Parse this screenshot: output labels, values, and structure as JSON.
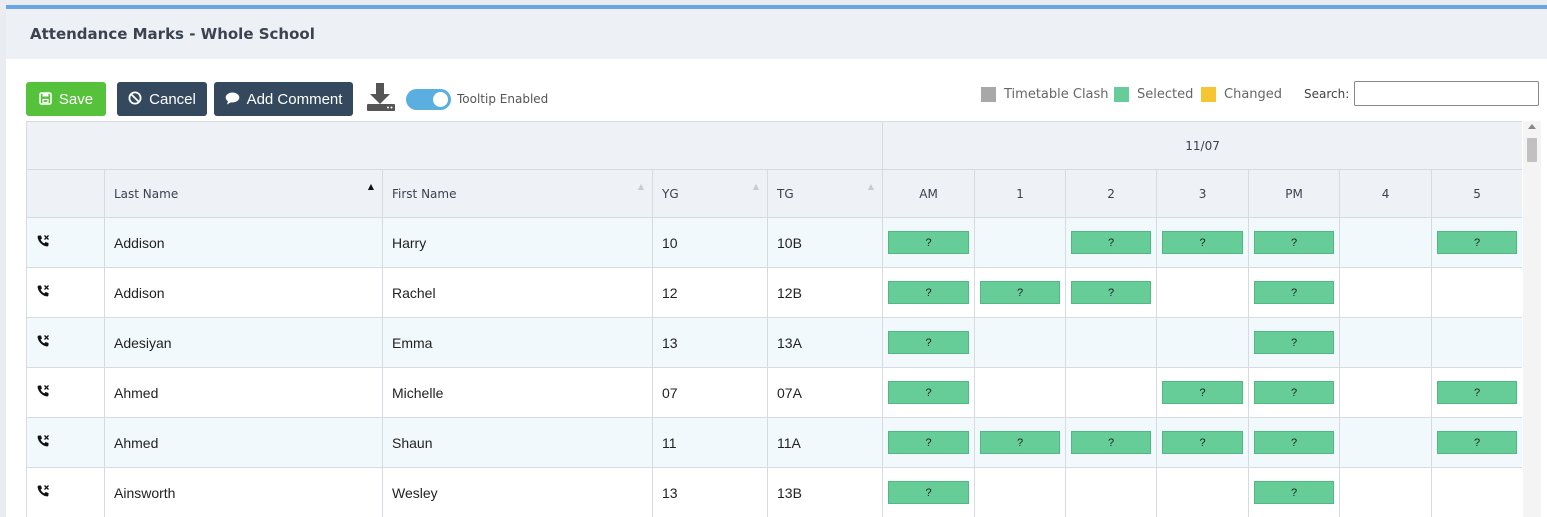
{
  "panel": {
    "title": "Attendance Marks - Whole School"
  },
  "toolbar": {
    "save_label": "Save",
    "cancel_label": "Cancel",
    "add_comment_label": "Add Comment",
    "download_icon": "download-icon",
    "tooltip_label": "Tooltip Enabled",
    "tooltip_enabled": true
  },
  "legend": {
    "timetable_clash": {
      "label": "Timetable Clash",
      "color": "#a8a8a8"
    },
    "selected": {
      "label": "Selected",
      "color": "#66cc98"
    },
    "changed": {
      "label": "Changed",
      "color": "#f7c531"
    }
  },
  "search": {
    "label": "Search:",
    "value": ""
  },
  "table": {
    "date": "11/07",
    "columns": {
      "last_name": "Last Name",
      "first_name": "First Name",
      "yg": "YG",
      "tg": "TG"
    },
    "periods": [
      "AM",
      "1",
      "2",
      "3",
      "PM",
      "4",
      "5"
    ],
    "rows": [
      {
        "last_name": "Addison",
        "first_name": "Harry",
        "yg": "10",
        "tg": "10B",
        "marks": [
          "?",
          "",
          "?",
          "?",
          "?",
          "",
          "?"
        ]
      },
      {
        "last_name": "Addison",
        "first_name": "Rachel",
        "yg": "12",
        "tg": "12B",
        "marks": [
          "?",
          "?",
          "?",
          "",
          "?",
          "",
          ""
        ]
      },
      {
        "last_name": "Adesiyan",
        "first_name": "Emma",
        "yg": "13",
        "tg": "13A",
        "marks": [
          "?",
          "",
          "",
          "",
          "?",
          "",
          ""
        ]
      },
      {
        "last_name": "Ahmed",
        "first_name": "Michelle",
        "yg": "07",
        "tg": "07A",
        "marks": [
          "?",
          "",
          "",
          "?",
          "?",
          "",
          "?"
        ]
      },
      {
        "last_name": "Ahmed",
        "first_name": "Shaun",
        "yg": "11",
        "tg": "11A",
        "marks": [
          "?",
          "?",
          "?",
          "?",
          "?",
          "",
          "?"
        ]
      },
      {
        "last_name": "Ainsworth",
        "first_name": "Wesley",
        "yg": "13",
        "tg": "13B",
        "marks": [
          "?",
          "",
          "",
          "",
          "?",
          "",
          ""
        ]
      }
    ]
  }
}
